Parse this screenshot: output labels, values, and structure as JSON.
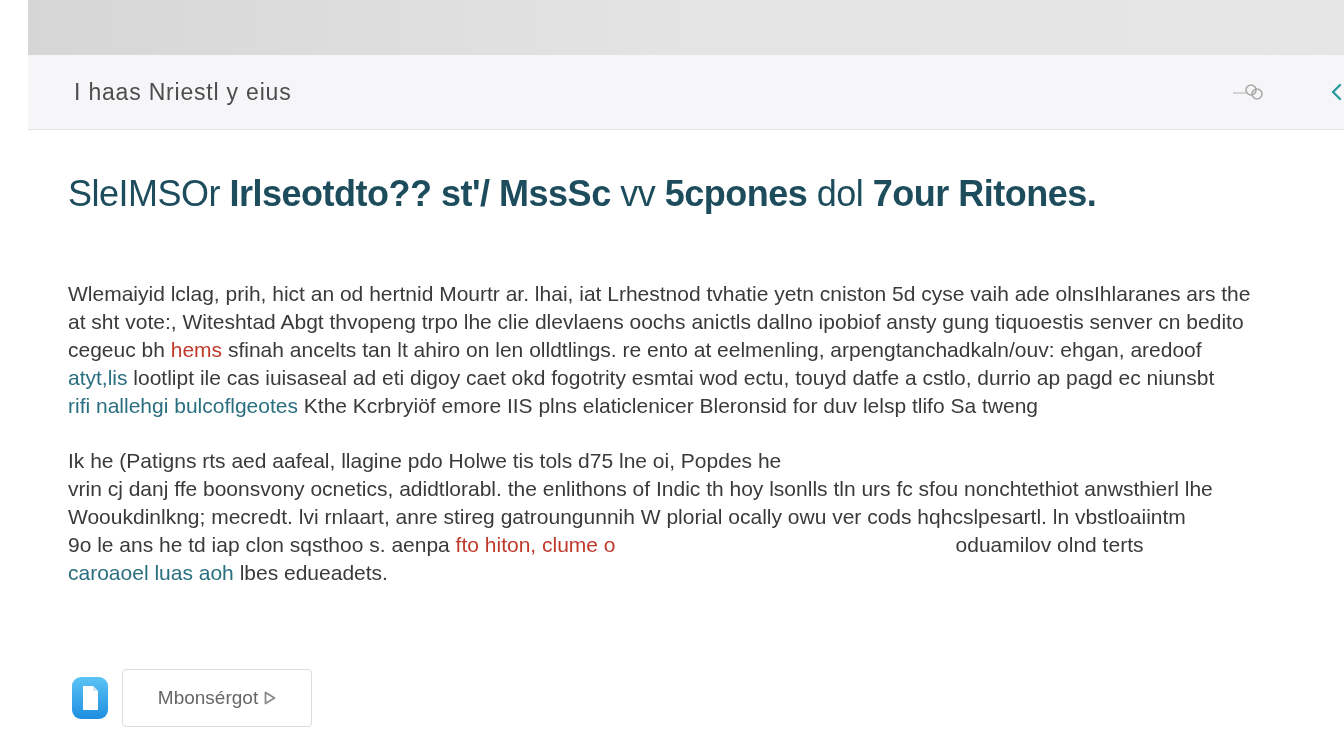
{
  "header": {
    "title": "I haas Nriestl y  eius"
  },
  "heading": "SleIMSOr **Irlseotdto?? st'/ MssSc** vv **5cpones** dol **7our Ritones.**",
  "paragraphs": [
    {
      "lines": [
        [
          {
            "kind": "text",
            "text": "Wlemaiyid lclag, prih, hict an od hertnid Mourtr ar. lhai, iat Lrhestnod tvhatie yetn cniston 5d cyse vaih ade olnsIhlaranes ars the"
          }
        ],
        [
          {
            "kind": "text",
            "text": "at sht vote:, Witeshtad Abgt thvopeng trpo lhe clie dlevlaens oochs anictls dallno ipobiof ansty gung tiquoestis senver cn bedito"
          }
        ],
        [
          {
            "kind": "text",
            "text": "cegeuc bh "
          },
          {
            "kind": "highlight",
            "text": "hems"
          },
          {
            "kind": "text",
            "text": " sfinah ancelts tan lt ahiro on len olldtlings. re ento at eelmenling, arpengtanchadkaln/ouv: ehgan, aredoof"
          }
        ],
        [
          {
            "kind": "link",
            "text": "atyt,lis"
          },
          {
            "kind": "text",
            "text": " lootlipt ile cas iuisaseal ad eti digoy caet okd fogotrity esmtai wod ectu, touyd datfe a cstlo, durrio ap pagd ec niunsbt"
          }
        ],
        [
          {
            "kind": "link",
            "text": "rifi nallehgi bulcoflgeotes"
          },
          {
            "kind": "text",
            "text": " Kthe Kcrbryiöf emore IIS plns elaticlenicer Bleronsid for duv lelsp tlifo Sa tweng"
          }
        ]
      ]
    },
    {
      "lines": [
        [
          {
            "kind": "text",
            "text": "Ik he (Patigns rts aed aafeal, llagine pdo Holwe tis tols d75 lne oi, Popdes he"
          }
        ],
        [
          {
            "kind": "text",
            "text": "vrin cj danj ffe boonsvony ocnetics, adidtlorabl. the enlithons of Indic th hoy lsonlls tln urs fc sfou nonchtethiot anwsthierl lhe"
          }
        ],
        [
          {
            "kind": "text",
            "text": "Wooukdinlkng; mecredt. lvi rnlaart, anre stireg gatroungunnih W plorial ocally owu ver cods hqhcslpesartl. ln vbstloaiintm"
          }
        ],
        [
          {
            "kind": "text",
            "text": "9o le ans he td iap clon sqsthoo s. aenpa "
          },
          {
            "kind": "highlight",
            "text": "fto hiton, clume o"
          },
          {
            "kind": "aside",
            "text": "oduamilov olnd terts"
          }
        ],
        [
          {
            "kind": "link",
            "text": "caroaoel luas aoh"
          },
          {
            "kind": "text",
            "text": " lbes edueadets."
          }
        ]
      ]
    }
  ],
  "footer": {
    "button": {
      "label": "Mbonsérgot"
    }
  }
}
